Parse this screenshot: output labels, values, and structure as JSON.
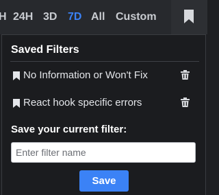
{
  "time_range": {
    "tabs": [
      "H",
      "24H",
      "3D",
      "7D",
      "All",
      "Custom"
    ],
    "active": "7D"
  },
  "bookmark_toggle": {
    "icon": "bookmark-icon"
  },
  "saved_filters": {
    "title": "Saved Filters",
    "items": [
      {
        "label": "No Information or Won't Fix",
        "icon": "bookmark-icon",
        "delete_icon": "trash-icon"
      },
      {
        "label": "React hook specific errors",
        "icon": "bookmark-icon",
        "delete_icon": "trash-icon"
      }
    ]
  },
  "save_form": {
    "heading": "Save your current filter:",
    "placeholder": "Enter filter name",
    "value": "",
    "save_label": "Save"
  },
  "colors": {
    "accent": "#3b82f6",
    "panel_bg": "#1b1c1f",
    "topbar_bg": "#27292d"
  }
}
